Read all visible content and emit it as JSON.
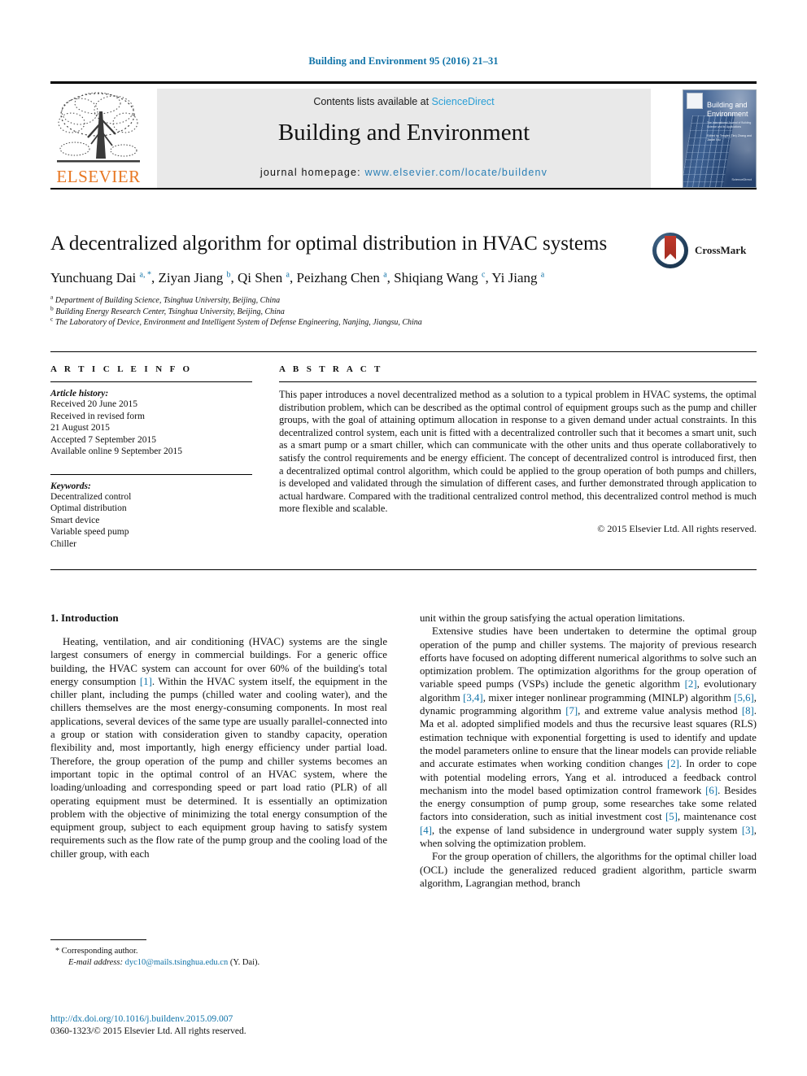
{
  "running_head": "Building and Environment 95 (2016) 21–31",
  "masthead": {
    "publisher_wordmark": "ELSEVIER",
    "contents_prefix": "Contents lists available at ",
    "contents_link": "ScienceDirect",
    "journal_title": "Building and Environment",
    "homepage_prefix": "journal homepage: ",
    "homepage_url": "www.elsevier.com/locate/buildenv",
    "cover": {
      "title": "Building and Environment",
      "subtitle": "The International Journal of Building Science and its Applications",
      "subtitle2": "Edited by Tengfei (Tim) Zhang and Jianlei Niu",
      "footer": "ScienceDirect"
    }
  },
  "article": {
    "title": "A decentralized algorithm for optimal distribution in HVAC systems",
    "crossmark_label": "CrossMark",
    "authors": [
      {
        "name": "Yunchuang Dai",
        "marks": "a, *"
      },
      {
        "name": "Ziyan Jiang",
        "marks": "b"
      },
      {
        "name": "Qi Shen",
        "marks": "a"
      },
      {
        "name": "Peizhang Chen",
        "marks": "a"
      },
      {
        "name": "Shiqiang Wang",
        "marks": "c"
      },
      {
        "name": "Yi Jiang",
        "marks": "a"
      }
    ],
    "affiliations": [
      {
        "mark": "a",
        "text": "Department of Building Science, Tsinghua University, Beijing, China"
      },
      {
        "mark": "b",
        "text": "Building Energy Research Center, Tsinghua University, Beijing, China"
      },
      {
        "mark": "c",
        "text": "The Laboratory of Device, Environment and Intelligent System of Defense Engineering, Nanjing, Jiangsu, China"
      }
    ]
  },
  "info": {
    "heading": "A R T I C L E   I N F O",
    "history_label": "Article history:",
    "history": [
      "Received 20 June 2015",
      "Received in revised form",
      "21 August 2015",
      "Accepted 7 September 2015",
      "Available online 9 September 2015"
    ],
    "keywords_label": "Keywords:",
    "keywords": [
      "Decentralized control",
      "Optimal distribution",
      "Smart device",
      "Variable speed pump",
      "Chiller"
    ]
  },
  "abstract": {
    "heading": "A B S T R A C T",
    "text": "This paper introduces a novel decentralized method as a solution to a typical problem in HVAC systems, the optimal distribution problem, which can be described as the optimal control of equipment groups such as the pump and chiller groups, with the goal of attaining optimum allocation in response to a given demand under actual constraints. In this decentralized control system, each unit is fitted with a decentralized controller such that it becomes a smart unit, such as a smart pump or a smart chiller, which can communicate with the other units and thus operate collaboratively to satisfy the control requirements and be energy efficient. The concept of decentralized control is introduced first, then a decentralized optimal control algorithm, which could be applied to the group operation of both pumps and chillers, is developed and validated through the simulation of different cases, and further demonstrated through application to actual hardware. Compared with the traditional centralized control method, this decentralized control method is much more flexible and scalable.",
    "copyright": "© 2015 Elsevier Ltd. All rights reserved."
  },
  "body": {
    "section_heading": "1. Introduction",
    "left_paragraphs": [
      "Heating, ventilation, and air conditioning (HVAC) systems are the single largest consumers of energy in commercial buildings. For a generic office building, the HVAC system can account for over 60% of the building's total energy consumption [1]. Within the HVAC system itself, the equipment in the chiller plant, including the pumps (chilled water and cooling water), and the chillers themselves are the most energy-consuming components. In most real applications, several devices of the same type are usually parallel-connected into a group or station with consideration given to standby capacity, operation flexibility and, most importantly, high energy efficiency under partial load. Therefore, the group operation of the pump and chiller systems becomes an important topic in the optimal control of an HVAC system, where the loading/unloading and corresponding speed or part load ratio (PLR) of all operating equipment must be determined. It is essentially an optimization problem with the objective of minimizing the total energy consumption of the equipment group, subject to each equipment group having to satisfy system requirements such as the flow rate of the pump group and the cooling load of the chiller group, with each"
    ],
    "right_paragraphs": [
      "unit within the group satisfying the actual operation limitations.",
      "Extensive studies have been undertaken to determine the optimal group operation of the pump and chiller systems. The majority of previous research efforts have focused on adopting different numerical algorithms to solve such an optimization problem. The optimization algorithms for the group operation of variable speed pumps (VSPs) include the genetic algorithm [2], evolutionary algorithm [3,4], mixer integer nonlinear programming (MINLP) algorithm [5,6], dynamic programming algorithm [7], and extreme value analysis method [8]. Ma et al. adopted simplified models and thus the recursive least squares (RLS) estimation technique with exponential forgetting is used to identify and update the model parameters online to ensure that the linear models can provide reliable and accurate estimates when working condition changes [2]. In order to cope with potential modeling errors, Yang et al. introduced a feedback control mechanism into the model based optimization control framework [6]. Besides the energy consumption of pump group, some researches take some related factors into consideration, such as initial investment cost [5], maintenance cost [4], the expense of land subsidence in underground water supply system [3], when solving the optimization problem.",
      "For the group operation of chillers, the algorithms for the optimal chiller load (OCL) include the generalized reduced gradient algorithm, particle swarm algorithm, Lagrangian method, branch"
    ]
  },
  "footer": {
    "corresponding_marker": "*",
    "corresponding_label": "Corresponding author.",
    "email_label": "E-mail address:",
    "email": "dyc10@mails.tsinghua.edu.cn",
    "email_owner": "(Y. Dai).",
    "doi": "http://dx.doi.org/10.1016/j.buildenv.2015.09.007",
    "issn_line": "0360-1323/© 2015 Elsevier Ltd. All rights reserved."
  },
  "colors": {
    "link_blue": "#1073a8",
    "sciencedirect_blue": "#2a9fd6",
    "elsevier_orange": "#E87722"
  }
}
